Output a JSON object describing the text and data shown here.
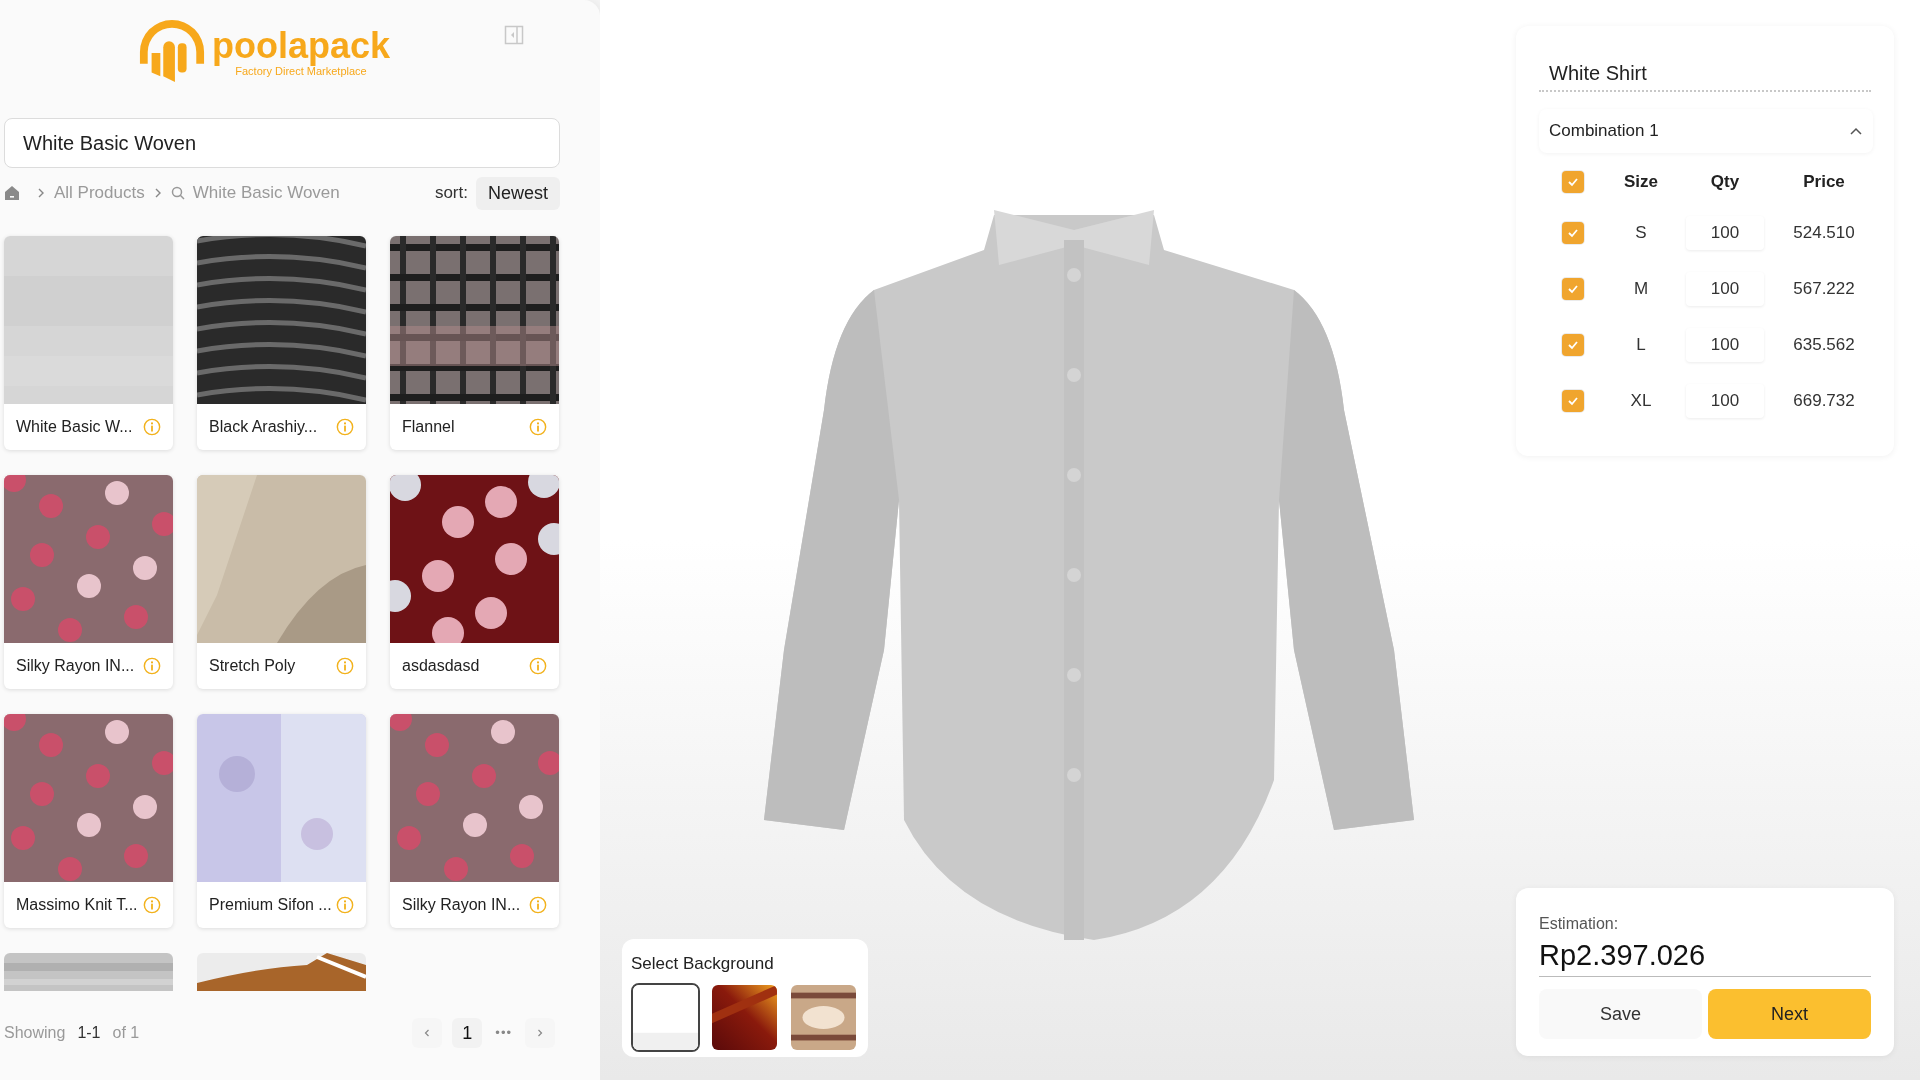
{
  "brand": {
    "name": "poolapack",
    "tagline": "Factory Direct Marketplace"
  },
  "search": {
    "value": "White Basic Woven"
  },
  "breadcrumb": {
    "items": [
      "All Products",
      "White Basic Woven"
    ]
  },
  "sort": {
    "label": "sort:",
    "value": "Newest"
  },
  "products": [
    {
      "name": "White Basic W..."
    },
    {
      "name": "Black Arashiy..."
    },
    {
      "name": "Flannel"
    },
    {
      "name": "Silky Rayon IN..."
    },
    {
      "name": "Stretch Poly"
    },
    {
      "name": "asdasdasd"
    },
    {
      "name": "Massimo Knit T..."
    },
    {
      "name": "Premium Sifon ..."
    },
    {
      "name": "Silky Rayon IN..."
    }
  ],
  "pagination": {
    "showing": "Showing",
    "range": "1-1",
    "total": "of 1",
    "pages": [
      {
        "label": "1",
        "selected": true
      }
    ],
    "ellipsis": "•••"
  },
  "backgrounds": {
    "title": "Select Background",
    "options": [
      {
        "kind": "white",
        "selected": true
      },
      {
        "kind": "red",
        "selected": false
      },
      {
        "kind": "room",
        "selected": false
      }
    ]
  },
  "order": {
    "title": "White Shirt",
    "combination": "Combination 1",
    "expanded": true,
    "columns": [
      "Size",
      "Qty",
      "Price"
    ],
    "all_checked": true,
    "rows": [
      {
        "checked": true,
        "size": "S",
        "qty": "100",
        "price": "524.510"
      },
      {
        "checked": true,
        "size": "M",
        "qty": "100",
        "price": "567.222"
      },
      {
        "checked": true,
        "size": "L",
        "qty": "100",
        "price": "635.562"
      },
      {
        "checked": true,
        "size": "XL",
        "qty": "100",
        "price": "669.732"
      }
    ]
  },
  "estimation": {
    "label": "Estimation:",
    "value": "Rp2.397.026",
    "buttons": [
      {
        "label": "Save",
        "kind": "secondary"
      },
      {
        "label": "Next",
        "kind": "primary"
      }
    ]
  }
}
